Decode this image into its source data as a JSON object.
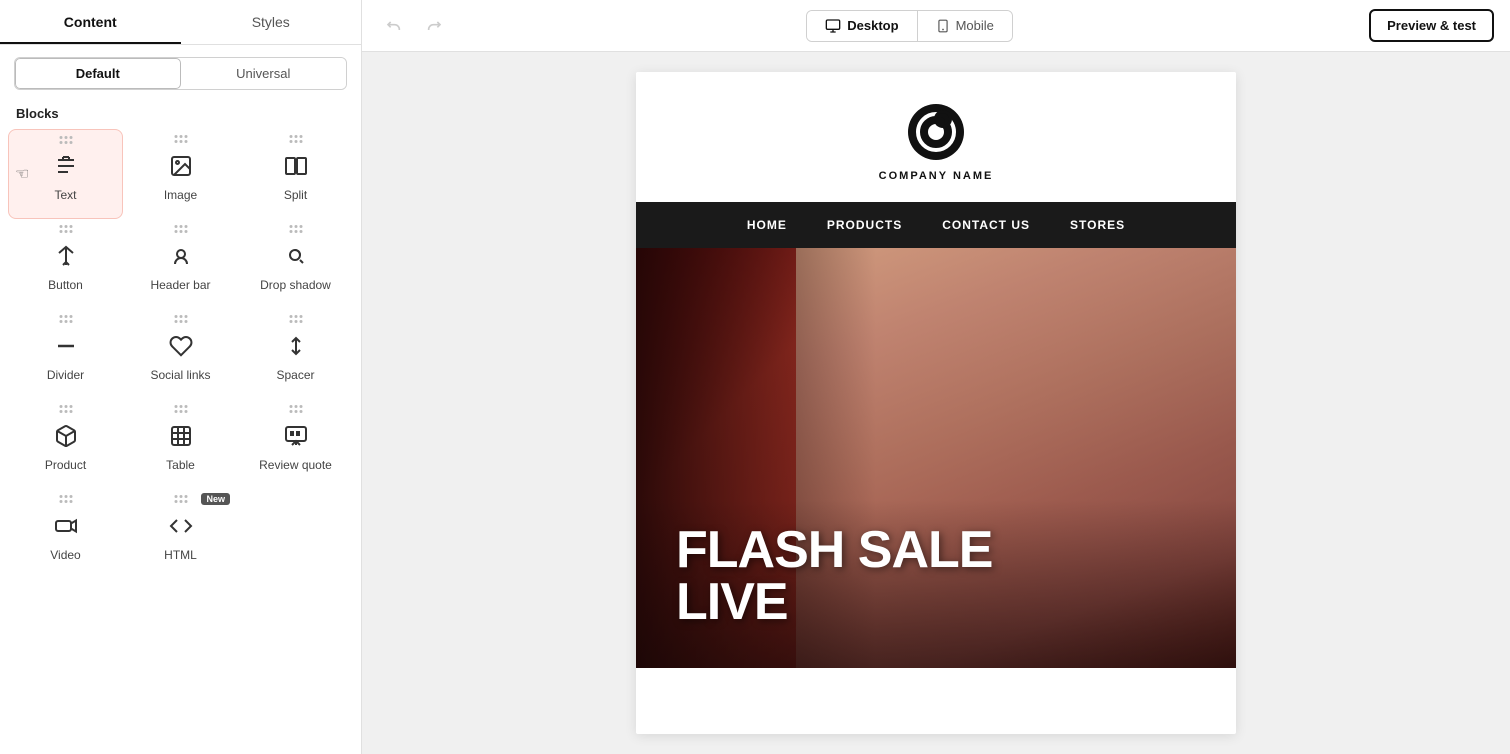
{
  "tabs": {
    "content": "Content",
    "styles": "Styles"
  },
  "scope": {
    "default": "Default",
    "universal": "Universal"
  },
  "blocks_title": "Blocks",
  "blocks": [
    {
      "id": "text",
      "label": "Text",
      "icon": "text-icon",
      "selected": true
    },
    {
      "id": "image",
      "label": "Image",
      "icon": "image-icon"
    },
    {
      "id": "split",
      "label": "Split",
      "icon": "split-icon"
    },
    {
      "id": "button",
      "label": "Button",
      "icon": "button-icon"
    },
    {
      "id": "header-bar",
      "label": "Header bar",
      "icon": "header-bar-icon"
    },
    {
      "id": "drop-shadow",
      "label": "Drop shadow",
      "icon": "drop-shadow-icon"
    },
    {
      "id": "divider",
      "label": "Divider",
      "icon": "divider-icon"
    },
    {
      "id": "social-links",
      "label": "Social links",
      "icon": "social-links-icon"
    },
    {
      "id": "spacer",
      "label": "Spacer",
      "icon": "spacer-icon"
    },
    {
      "id": "product",
      "label": "Product",
      "icon": "product-icon"
    },
    {
      "id": "table",
      "label": "Table",
      "icon": "table-icon"
    },
    {
      "id": "review-quote",
      "label": "Review quote",
      "icon": "review-quote-icon"
    },
    {
      "id": "video",
      "label": "Video",
      "icon": "video-icon"
    },
    {
      "id": "html",
      "label": "HTML",
      "icon": "html-icon",
      "badge": "New"
    }
  ],
  "toolbar": {
    "undo_title": "Undo",
    "redo_title": "Redo",
    "desktop_label": "Desktop",
    "mobile_label": "Mobile",
    "preview_label": "Preview & test"
  },
  "email": {
    "company_name": "COMPANY NAME",
    "nav_items": [
      "HOME",
      "PRODUCTS",
      "CONTACT US",
      "STORES"
    ],
    "hero_line1": "FLASH SALE",
    "hero_line2": "LIVE"
  }
}
